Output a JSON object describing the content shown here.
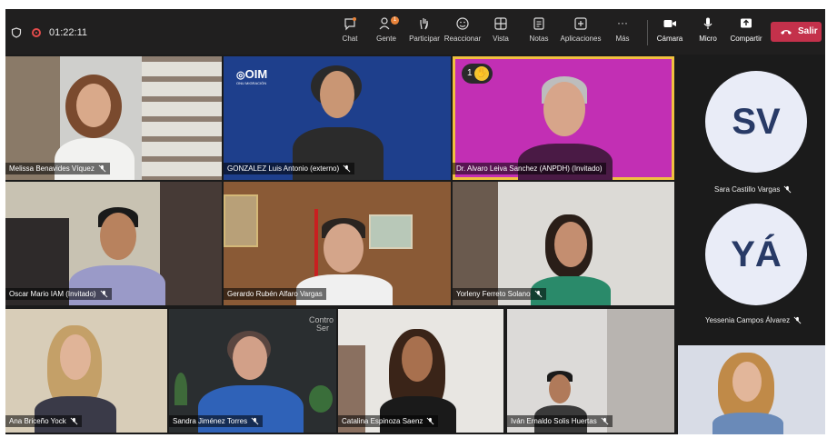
{
  "meeting": {
    "timer": "01:22:11"
  },
  "toolbar": {
    "chat": "Chat",
    "people": "Gente",
    "people_badge": "1",
    "raise": "Participar",
    "react": "Reaccionar",
    "view": "Vista",
    "notes": "Notas",
    "apps": "Aplicaciones",
    "more": "Más",
    "camera": "Cámara",
    "mic": "Micro",
    "share": "Compartir",
    "leave": "Salir"
  },
  "tiles": [
    {
      "name": "Melissa Benavides Víquez"
    },
    {
      "name": "GONZALEZ Luis Antonio (externo)",
      "logo": "OIM",
      "logo_sub": "ONU MIGRACIÓN"
    },
    {
      "name": "Dr. Alvaro Leiva Sanchez (ANPDH) (Invitado)",
      "hand_count": "1"
    },
    {
      "name": "Oscar Mario IAM (Invitado)"
    },
    {
      "name": "Gerardo Rubén Alfaro Vargas"
    },
    {
      "name": "Yorleny Ferreto Solano"
    },
    {
      "name": "Ana Briceño Yock"
    },
    {
      "name": "Sandra Jiménez Torres",
      "wall_text": "Contro",
      "wall_text2": "Ser"
    },
    {
      "name": "Catalina Espinoza Saenz"
    },
    {
      "name": "Iván Ernaldo Solis Huertas"
    },
    {
      "name": ""
    }
  ],
  "side": [
    {
      "initials": "SV",
      "name": "Sara Castillo Vargas"
    },
    {
      "initials": "YÁ",
      "name": "Yessenia Campos Álvarez"
    }
  ],
  "colors": {
    "leave": "#c4314b",
    "avatar_bg": "#e9ecf7",
    "avatar_text": "#283a66",
    "oim_bg": "#1e3f8c",
    "invited_bg": "#c22fb4",
    "active_border": "#f0c040"
  }
}
